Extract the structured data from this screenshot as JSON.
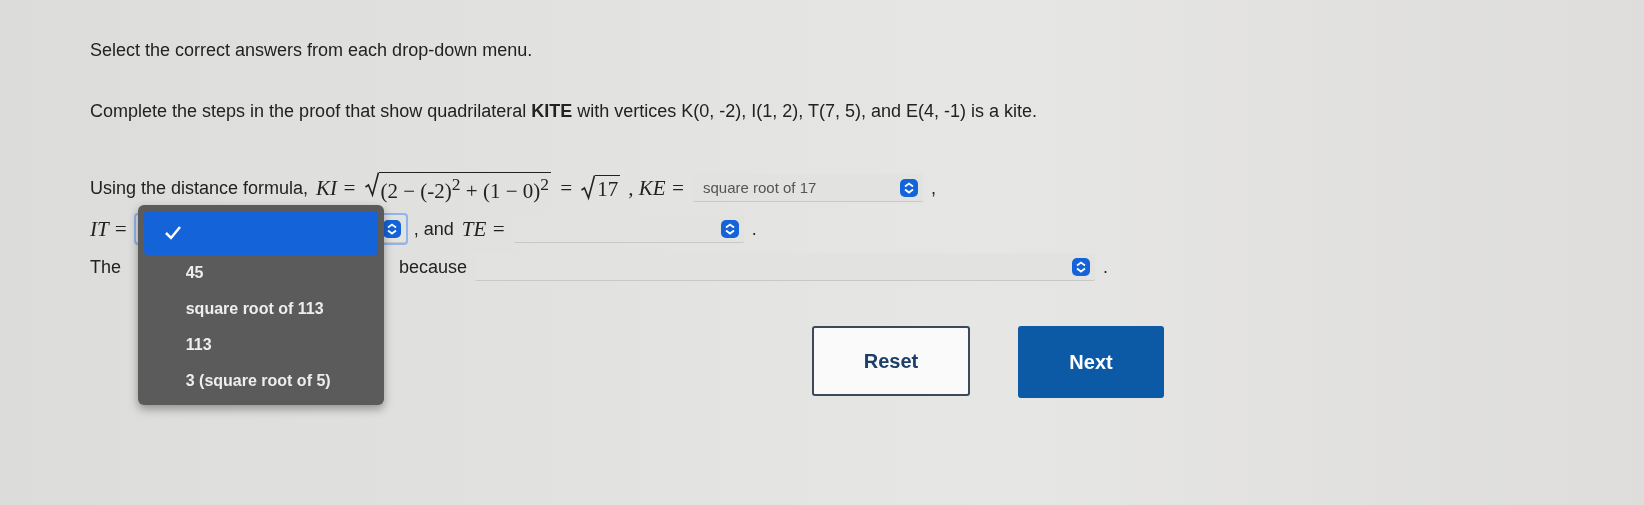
{
  "instruction": "Select the correct answers from each drop-down menu.",
  "prompt": "Complete the steps in the proof that show quadrilateral **KITE** with vertices K(0, -2), I(1, 2), T(7, 5), and E(4, -1) is a kite.",
  "lines": [
    {
      "parts": [
        {
          "kind": "text",
          "text": "Using the distance formula,"
        },
        {
          "kind": "math",
          "text": "KI ="
        },
        {
          "kind": "sqrt",
          "text": "(2 − (-2)$^{2}$ + (1 − 0)$^{2}$"
        },
        {
          "kind": "math",
          "text": "="
        },
        {
          "kind": "sqrt",
          "text": "17"
        },
        {
          "kind": "math",
          "text": ", KE ="
        },
        {
          "kind": "dropdown",
          "value": "square root of 17"
        },
        {
          "kind": "text",
          "text": ","
        }
      ]
    },
    {
      "parts": [
        {
          "kind": "math",
          "text": "IT ="
        },
        {
          "kind": "dropdown",
          "open": true
        },
        {
          "kind": "text",
          "text": ", and"
        },
        {
          "kind": "math",
          "text": "TE ="
        },
        {
          "kind": "dropdown"
        },
        {
          "kind": "text",
          "text": "."
        }
      ]
    },
    {
      "parts": [
        {
          "kind": "text",
          "text": "The"
        },
        {
          "kind": "text",
          "text": "because"
        },
        {
          "kind": "wide_dropdown"
        },
        {
          "kind": "text",
          "text": "."
        }
      ]
    }
  ],
  "menu": {
    "options": [
      {
        "selected": true
      },
      {
        "label": "45",
        "selected": false
      },
      {
        "label": "square root of 113",
        "selected": false
      },
      {
        "label": "113",
        "selected": false
      },
      {
        "label": "3 (square root of 5)",
        "selected": false
      }
    ]
  },
  "buttons": [
    {
      "label": "Reset",
      "kind": "secondary"
    },
    {
      "label": "Next",
      "kind": "primary"
    }
  ]
}
